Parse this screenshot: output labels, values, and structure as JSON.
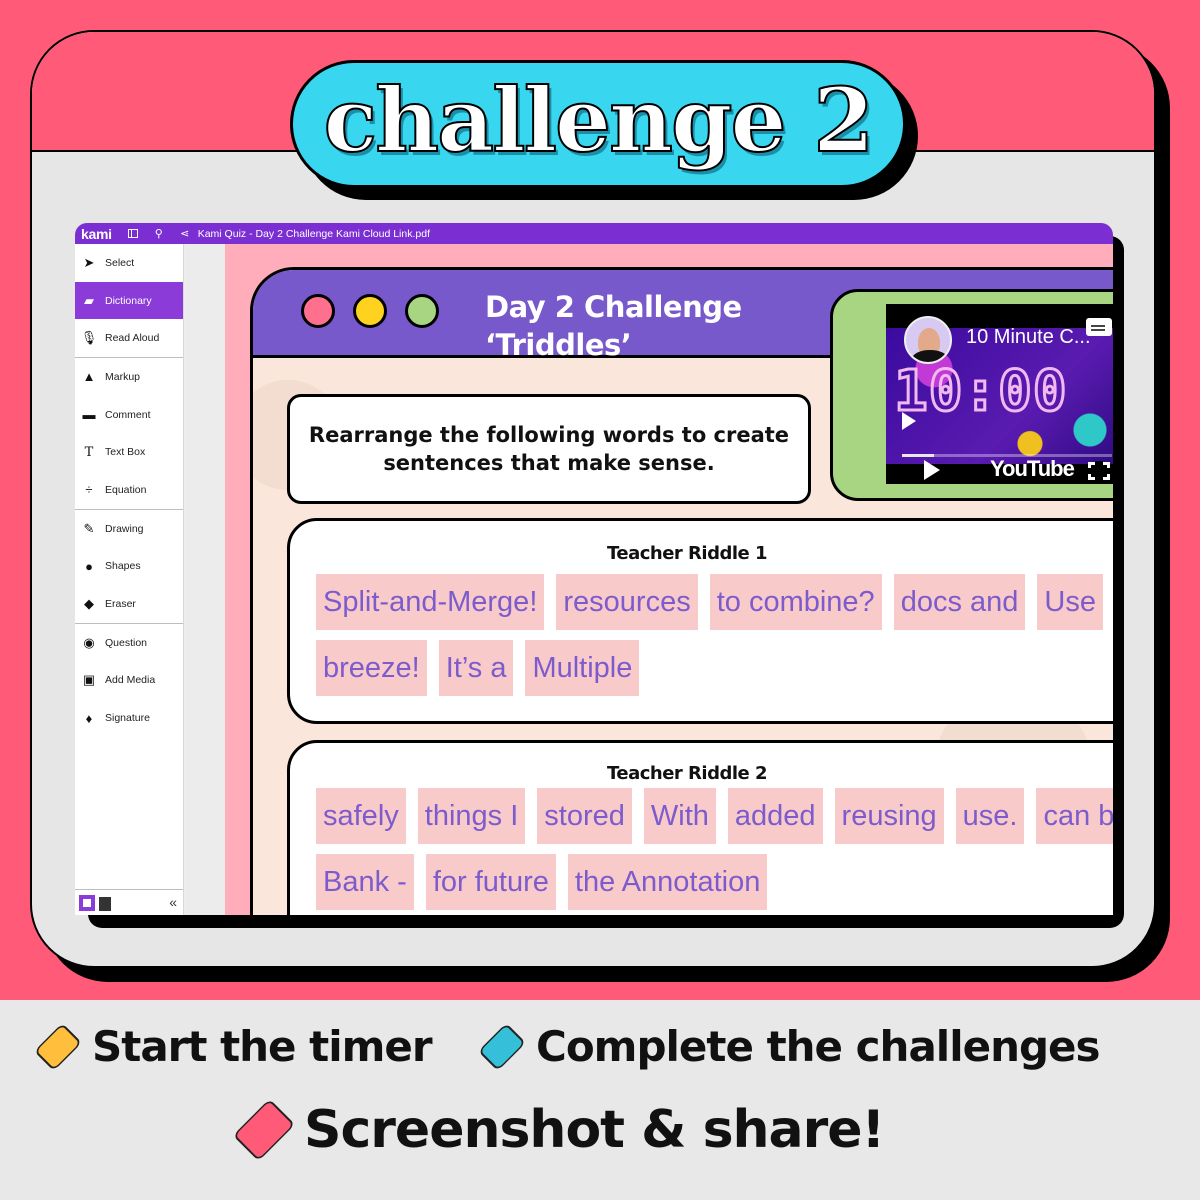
{
  "banner": {
    "title": "challenge 2"
  },
  "kami": {
    "logo": "kami",
    "document_title": "Kami Quiz - Day 2 Challenge Kami Cloud Link.pdf",
    "tools": [
      {
        "label": "Select",
        "icon": "cursor-icon",
        "active": false
      },
      {
        "label": "Dictionary",
        "icon": "book-icon",
        "active": true
      },
      {
        "label": "Read Aloud",
        "icon": "microphone-icon",
        "active": false
      },
      {
        "label": "Markup",
        "icon": "markup-icon",
        "active": false
      },
      {
        "label": "Comment",
        "icon": "comment-icon",
        "active": false
      },
      {
        "label": "Text Box",
        "icon": "text-icon",
        "active": false
      },
      {
        "label": "Equation",
        "icon": "divide-icon",
        "active": false
      },
      {
        "label": "Drawing",
        "icon": "brush-icon",
        "active": false
      },
      {
        "label": "Shapes",
        "icon": "shapes-icon",
        "active": false
      },
      {
        "label": "Eraser",
        "icon": "eraser-icon",
        "active": false
      },
      {
        "label": "Question",
        "icon": "question-icon",
        "active": false
      },
      {
        "label": "Add Media",
        "icon": "image-icon",
        "active": false
      },
      {
        "label": "Signature",
        "icon": "pen-nib-icon",
        "active": false
      }
    ],
    "collapse_glyph": "«"
  },
  "slide": {
    "title_line1": "Day 2 Challenge",
    "title_line2": "‘Triddles’",
    "instructions": "Rearrange the following words to create sentences that make sense.",
    "window_dot_colors": [
      "#ff6f8e",
      "#ffd21f",
      "#a7d582"
    ],
    "video": {
      "title": "10 Minute C...",
      "timer": "10:00",
      "platform": "YouTube",
      "progress": 0.15
    },
    "riddles": [
      {
        "title": "Teacher Riddle 1",
        "words": [
          "Split-and-Merge!",
          "resources",
          "to combine?",
          "docs and",
          "Use",
          "breeze!",
          "It’s a",
          "Multiple"
        ]
      },
      {
        "title": "Teacher Riddle 2",
        "words": [
          "safely",
          "things I",
          "stored",
          "With",
          "added",
          "reusing",
          "use.",
          "can be",
          "Bank -",
          "for future",
          "the Annotation"
        ]
      }
    ]
  },
  "steps": [
    {
      "label": "Start the timer",
      "color": "#ffbf3c"
    },
    {
      "label": "Complete the challenges",
      "color": "#35bfd9"
    },
    {
      "label": "Screenshot & share!",
      "color": "#ff5a78"
    }
  ]
}
